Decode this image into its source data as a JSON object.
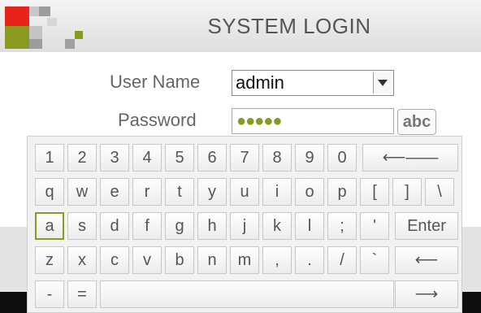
{
  "header": {
    "title": "SYSTEM LOGIN"
  },
  "logo": {
    "colors": [
      "#e8231b",
      "#8a9a20",
      "#c4c4c4",
      "#a0a0a0",
      "#d8d8d8"
    ]
  },
  "form": {
    "username_label": "User Name",
    "username_value": "admin",
    "password_label": "Password",
    "password_value": "●●●●●",
    "mode_button": "abc"
  },
  "keyboard": {
    "selected_key": "a",
    "rows": [
      [
        "1",
        "2",
        "3",
        "4",
        "5",
        "6",
        "7",
        "8",
        "9",
        "0",
        "⟵——"
      ],
      [
        "q",
        "w",
        "e",
        "r",
        "t",
        "y",
        "u",
        "i",
        "o",
        "p",
        "[",
        "]",
        "\\"
      ],
      [
        "a",
        "s",
        "d",
        "f",
        "g",
        "h",
        "j",
        "k",
        "l",
        ";",
        "'",
        "Enter"
      ],
      [
        "z",
        "x",
        "c",
        "v",
        "b",
        "n",
        "m",
        ",",
        ".",
        "/",
        "`",
        "⟵"
      ],
      [
        "-",
        "=",
        "",
        "⟶"
      ]
    ]
  },
  "colors": {
    "accent": "#8a9a20",
    "brand_red": "#e8231b"
  }
}
